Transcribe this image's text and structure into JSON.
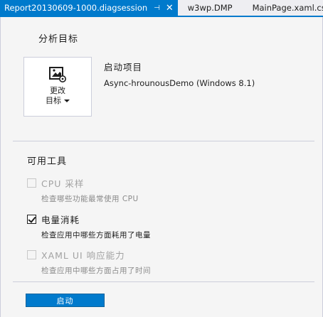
{
  "tabs": [
    {
      "label": "Report20130609-1000.diagsession",
      "active": true
    },
    {
      "label": "w3wp.DMP",
      "active": false
    },
    {
      "label": "MainPage.xaml.cs",
      "active": false
    }
  ],
  "tab_icons": {
    "pin": "⊣",
    "close": "✕"
  },
  "analysis_target": {
    "heading": "分析目标",
    "change_target_line1": "更改",
    "change_target_line2": "目标",
    "start_project_label": "启动项目",
    "start_project_value": "Async-hrounousDemo (Windows 8.1)"
  },
  "available_tools": {
    "heading": "可用工具",
    "tools": [
      {
        "name": "CPU 采样",
        "description": "检查哪些功能最常使用 CPU",
        "checked": false,
        "enabled": false
      },
      {
        "name": "电量消耗",
        "description": "检查应用中哪些方面耗用了电量",
        "checked": true,
        "enabled": true
      },
      {
        "name": "XAML UI 响应能力",
        "description": "检查应用中哪些方面占用了时间",
        "checked": false,
        "enabled": false
      }
    ]
  },
  "start_button_label": "启动",
  "colors": {
    "accent": "#007acc",
    "background": "#f5f5f5",
    "disabled_text": "#a2a2a2"
  }
}
